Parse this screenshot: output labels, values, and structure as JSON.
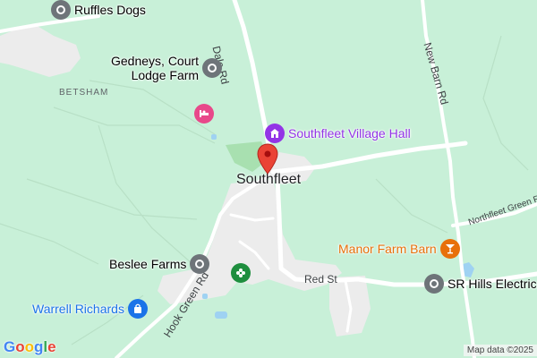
{
  "map": {
    "town_label": "Southfleet",
    "area_label": "BETSHAM",
    "roads": {
      "dale_rd": "Dale Rd",
      "new_barn_rd": "New Barn Rd",
      "northfleet_green": "Northfleet Green R",
      "red_st": "Red St",
      "hook_green_rd": "Hook Green Rd"
    },
    "pois": {
      "ruffles_dogs": "Ruffles Dogs",
      "gedneys_line1": "Gedneys, Court",
      "gedneys_line2": "Lodge Farm",
      "village_hall": "Southfleet Village Hall",
      "manor_farm_barn": "Manor Farm Barn",
      "beslee_farms": "Beslee Farms",
      "warrell_richards": "Warrell Richards",
      "sr_hills": "SR Hills Electrica"
    },
    "colors": {
      "land": "#c8f0d8",
      "park": "#a8e0b0",
      "urban": "#ececec",
      "road": "#ffffff",
      "water": "#9fd2f2",
      "hall_purple": "#9334e6",
      "pink": "#e8488a",
      "orange": "#e8700a",
      "blue": "#1a73e8",
      "green_icon": "#1e8e3e",
      "grey_icon": "#6e7479",
      "pin_red": "#ea4335"
    },
    "icons": {
      "place": "place-icon",
      "hotel": "hotel-icon",
      "hall": "hall-icon",
      "bar": "cocktail-icon",
      "shop": "shopping-bag-icon",
      "park": "park-icon",
      "pin": "map-pin-icon"
    }
  },
  "footer": {
    "logo": "Google",
    "attribution": "Map data ©2025"
  }
}
